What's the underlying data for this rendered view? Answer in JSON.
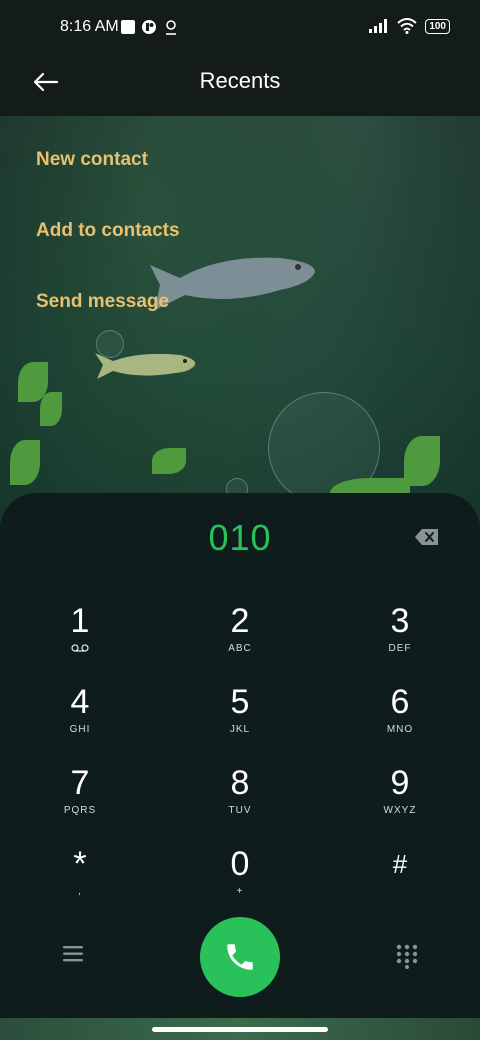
{
  "status_bar": {
    "time": "8:16 AM",
    "battery": "100",
    "icons": [
      "notification-square-icon",
      "app-icon",
      "location-icon",
      "signal-icon",
      "wifi-icon",
      "battery-icon"
    ]
  },
  "header": {
    "title": "Recents",
    "back_icon": "back-arrow-icon"
  },
  "menu": {
    "items": [
      {
        "label": "New contact"
      },
      {
        "label": "Add to contacts"
      },
      {
        "label": "Send message"
      }
    ]
  },
  "dialer": {
    "number": "010",
    "keys": [
      {
        "digit": "1",
        "letters": "voicemail-icon"
      },
      {
        "digit": "2",
        "letters": "ABC"
      },
      {
        "digit": "3",
        "letters": "DEF"
      },
      {
        "digit": "4",
        "letters": "GHI"
      },
      {
        "digit": "5",
        "letters": "JKL"
      },
      {
        "digit": "6",
        "letters": "MNO"
      },
      {
        "digit": "7",
        "letters": "PQRS"
      },
      {
        "digit": "8",
        "letters": "TUV"
      },
      {
        "digit": "9",
        "letters": "WXYZ"
      },
      {
        "digit": "*",
        "letters": ","
      },
      {
        "digit": "0",
        "letters": "+"
      },
      {
        "digit": "#",
        "letters": ""
      }
    ]
  },
  "colors": {
    "accent_green": "#29c15a",
    "menu_text": "#e8c070",
    "dialer_bg": "#0e1c1b"
  }
}
